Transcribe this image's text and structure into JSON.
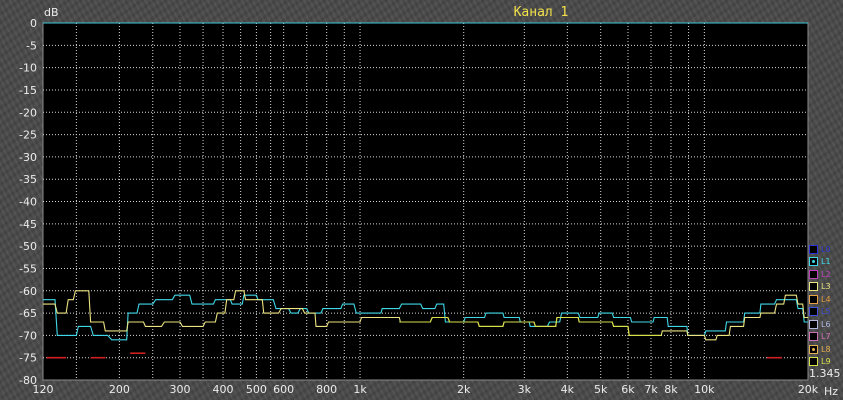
{
  "chart_data": {
    "type": "line",
    "title": "Канал 1",
    "ylabel": "dB",
    "xlabel": "Hz",
    "xscale": "log",
    "xlim": [
      120,
      20000
    ],
    "ylim": [
      -80,
      0
    ],
    "grid": true,
    "y_ticks": [
      "0",
      "-5",
      "-10",
      "-15",
      "-20",
      "-25",
      "-30",
      "-35",
      "-40",
      "-45",
      "-50",
      "-55",
      "-60",
      "-65",
      "-70",
      "-75",
      "-80"
    ],
    "x_tick_labels": [
      {
        "v": 120,
        "label": "120"
      },
      {
        "v": 200,
        "label": "200"
      },
      {
        "v": 300,
        "label": "300"
      },
      {
        "v": 400,
        "label": "400"
      },
      {
        "v": 500,
        "label": "500"
      },
      {
        "v": 600,
        "label": "600"
      },
      {
        "v": 800,
        "label": "800"
      },
      {
        "v": 1000,
        "label": "1k"
      },
      {
        "v": 2000,
        "label": "2k"
      },
      {
        "v": 3000,
        "label": "3k"
      },
      {
        "v": 4000,
        "label": "4k"
      },
      {
        "v": 5000,
        "label": "5k"
      },
      {
        "v": 6000,
        "label": "6k"
      },
      {
        "v": 7000,
        "label": "7k"
      },
      {
        "v": 8000,
        "label": "8k"
      },
      {
        "v": 10000,
        "label": "10k"
      },
      {
        "v": 20000,
        "label": "20k"
      }
    ],
    "x_gridlines": [
      120,
      150,
      200,
      250,
      300,
      350,
      400,
      450,
      500,
      550,
      600,
      700,
      800,
      900,
      1000,
      2000,
      3000,
      4000,
      5000,
      6000,
      7000,
      8000,
      9000,
      10000,
      20000
    ],
    "corner_value": "1.345",
    "legend_position": "right",
    "series": [
      {
        "name": "L1",
        "color": "#3fd8e8",
        "points": [
          [
            120,
            -62
          ],
          [
            130,
            -62
          ],
          [
            132,
            -70
          ],
          [
            150,
            -70
          ],
          [
            152,
            -68
          ],
          [
            165,
            -68
          ],
          [
            168,
            -70
          ],
          [
            185,
            -70
          ],
          [
            190,
            -71
          ],
          [
            210,
            -71
          ],
          [
            212,
            -65
          ],
          [
            225,
            -65
          ],
          [
            228,
            -63
          ],
          [
            250,
            -63
          ],
          [
            255,
            -62
          ],
          [
            285,
            -62
          ],
          [
            290,
            -61
          ],
          [
            320,
            -61
          ],
          [
            325,
            -63
          ],
          [
            375,
            -63
          ],
          [
            380,
            -62
          ],
          [
            420,
            -62
          ],
          [
            425,
            -63
          ],
          [
            455,
            -63
          ],
          [
            460,
            -61
          ],
          [
            500,
            -61
          ],
          [
            505,
            -62
          ],
          [
            560,
            -62
          ],
          [
            570,
            -64
          ],
          [
            620,
            -64
          ],
          [
            630,
            -65
          ],
          [
            660,
            -65
          ],
          [
            670,
            -64
          ],
          [
            700,
            -64
          ],
          [
            710,
            -65
          ],
          [
            770,
            -65
          ],
          [
            780,
            -64
          ],
          [
            880,
            -64
          ],
          [
            890,
            -63
          ],
          [
            960,
            -63
          ],
          [
            975,
            -65
          ],
          [
            1150,
            -65
          ],
          [
            1160,
            -64
          ],
          [
            1300,
            -64
          ],
          [
            1320,
            -63
          ],
          [
            1500,
            -63
          ],
          [
            1520,
            -64
          ],
          [
            1650,
            -64
          ],
          [
            1670,
            -63
          ],
          [
            1750,
            -63
          ],
          [
            1770,
            -67
          ],
          [
            2000,
            -67
          ],
          [
            2020,
            -66
          ],
          [
            2300,
            -66
          ],
          [
            2320,
            -65
          ],
          [
            2600,
            -65
          ],
          [
            2620,
            -66
          ],
          [
            2900,
            -66
          ],
          [
            2920,
            -67
          ],
          [
            3100,
            -67
          ],
          [
            3120,
            -68
          ],
          [
            3500,
            -68
          ],
          [
            3550,
            -67
          ],
          [
            3800,
            -67
          ],
          [
            3850,
            -65
          ],
          [
            4300,
            -65
          ],
          [
            4350,
            -66
          ],
          [
            4900,
            -66
          ],
          [
            4950,
            -65
          ],
          [
            5400,
            -65
          ],
          [
            5450,
            -66
          ],
          [
            6100,
            -66
          ],
          [
            6150,
            -67
          ],
          [
            7100,
            -67
          ],
          [
            7150,
            -66
          ],
          [
            7800,
            -66
          ],
          [
            7850,
            -68
          ],
          [
            8900,
            -68
          ],
          [
            8950,
            -70
          ],
          [
            10000,
            -70
          ],
          [
            10100,
            -69
          ],
          [
            11500,
            -69
          ],
          [
            11600,
            -67
          ],
          [
            13000,
            -67
          ],
          [
            13100,
            -65
          ],
          [
            14500,
            -65
          ],
          [
            14600,
            -63
          ],
          [
            16000,
            -63
          ],
          [
            16200,
            -62
          ],
          [
            18500,
            -62
          ],
          [
            18700,
            -64
          ],
          [
            19300,
            -64
          ],
          [
            19500,
            -67
          ],
          [
            20000,
            -67
          ]
        ]
      },
      {
        "name": "L3",
        "color": "#ece480",
        "points": [
          [
            120,
            -63
          ],
          [
            130,
            -63
          ],
          [
            132,
            -65
          ],
          [
            140,
            -65
          ],
          [
            142,
            -62
          ],
          [
            147,
            -62
          ],
          [
            149,
            -60
          ],
          [
            163,
            -60
          ],
          [
            165,
            -67
          ],
          [
            180,
            -67
          ],
          [
            182,
            -69
          ],
          [
            210,
            -69
          ],
          [
            212,
            -67
          ],
          [
            235,
            -67
          ],
          [
            238,
            -68
          ],
          [
            265,
            -68
          ],
          [
            270,
            -67
          ],
          [
            300,
            -67
          ],
          [
            305,
            -68
          ],
          [
            350,
            -68
          ],
          [
            355,
            -67
          ],
          [
            380,
            -67
          ],
          [
            385,
            -65
          ],
          [
            405,
            -65
          ],
          [
            410,
            -62
          ],
          [
            430,
            -62
          ],
          [
            435,
            -60
          ],
          [
            460,
            -60
          ],
          [
            465,
            -62
          ],
          [
            520,
            -62
          ],
          [
            525,
            -65
          ],
          [
            580,
            -65
          ],
          [
            590,
            -64
          ],
          [
            680,
            -64
          ],
          [
            690,
            -65
          ],
          [
            740,
            -65
          ],
          [
            745,
            -68
          ],
          [
            800,
            -68
          ],
          [
            810,
            -67
          ],
          [
            1000,
            -67
          ],
          [
            1010,
            -66
          ],
          [
            1300,
            -66
          ],
          [
            1310,
            -67
          ],
          [
            1600,
            -67
          ],
          [
            1620,
            -66
          ],
          [
            1800,
            -66
          ],
          [
            1820,
            -67
          ],
          [
            2200,
            -67
          ],
          [
            2220,
            -68
          ],
          [
            2600,
            -68
          ],
          [
            2620,
            -67
          ],
          [
            3200,
            -67
          ],
          [
            3230,
            -68
          ],
          [
            3700,
            -68
          ],
          [
            3730,
            -66
          ],
          [
            4300,
            -66
          ],
          [
            4330,
            -67
          ],
          [
            5400,
            -67
          ],
          [
            5450,
            -68
          ],
          [
            6000,
            -68
          ],
          [
            6050,
            -70
          ],
          [
            7500,
            -70
          ],
          [
            7550,
            -69
          ],
          [
            8900,
            -69
          ],
          [
            8950,
            -70
          ],
          [
            10000,
            -70
          ],
          [
            10100,
            -71
          ],
          [
            10800,
            -71
          ],
          [
            10900,
            -70
          ],
          [
            11800,
            -70
          ],
          [
            11900,
            -68
          ],
          [
            13000,
            -68
          ],
          [
            13100,
            -66
          ],
          [
            14500,
            -66
          ],
          [
            14600,
            -65
          ],
          [
            16000,
            -65
          ],
          [
            16200,
            -63
          ],
          [
            17000,
            -63
          ],
          [
            17200,
            -61
          ],
          [
            18500,
            -61
          ],
          [
            18700,
            -63
          ],
          [
            19300,
            -63
          ],
          [
            19500,
            -66
          ],
          [
            20000,
            -66
          ]
        ]
      },
      {
        "name": "L9",
        "color": "#d8e048",
        "points": [
          [
            1300,
            -67
          ],
          [
            1600,
            -67
          ],
          [
            1620,
            -66
          ],
          [
            1800,
            -66
          ],
          [
            1820,
            -67
          ],
          [
            2200,
            -67
          ],
          [
            2220,
            -68
          ],
          [
            2600,
            -68
          ],
          [
            2620,
            -67
          ],
          [
            3200,
            -67
          ],
          [
            3230,
            -68
          ],
          [
            3700,
            -68
          ],
          [
            3730,
            -66
          ],
          [
            4300,
            -66
          ],
          [
            4330,
            -67
          ],
          [
            5400,
            -67
          ],
          [
            5450,
            -68
          ],
          [
            6000,
            -68
          ],
          [
            6050,
            -70
          ],
          [
            7500,
            -70
          ]
        ]
      },
      {
        "name": "red",
        "color": "#d02020",
        "points": [
          [
            123,
            -75
          ],
          [
            140,
            -75
          ]
        ]
      },
      {
        "name": "red",
        "color": "#d02020",
        "points": [
          [
            165,
            -75
          ],
          [
            182,
            -75
          ]
        ]
      },
      {
        "name": "red",
        "color": "#d02020",
        "points": [
          [
            215,
            -74
          ],
          [
            238,
            -74
          ]
        ]
      },
      {
        "name": "red",
        "color": "#d02020",
        "points": [
          [
            15200,
            -75
          ],
          [
            16800,
            -75
          ]
        ]
      }
    ]
  },
  "legend": [
    {
      "label": "L0",
      "color": "#2a34d8",
      "dot": ""
    },
    {
      "label": "L1",
      "color": "#3fd8e8",
      "dot": "#3fd8e8"
    },
    {
      "label": "L2",
      "color": "#c040c0",
      "dot": ""
    },
    {
      "label": "L3",
      "color": "#ece480",
      "dot": ""
    },
    {
      "label": "L4",
      "color": "#e8a040",
      "dot": ""
    },
    {
      "label": "L5",
      "color": "#4050d8",
      "dot": ""
    },
    {
      "label": "L6",
      "color": "#b0b8e0",
      "dot": ""
    },
    {
      "label": "L7",
      "color": "#d070b8",
      "dot": ""
    },
    {
      "label": "L8",
      "color": "#e8b050",
      "dot": "#e8b050"
    },
    {
      "label": "L9",
      "color": "#d8e048",
      "dot": ""
    }
  ]
}
